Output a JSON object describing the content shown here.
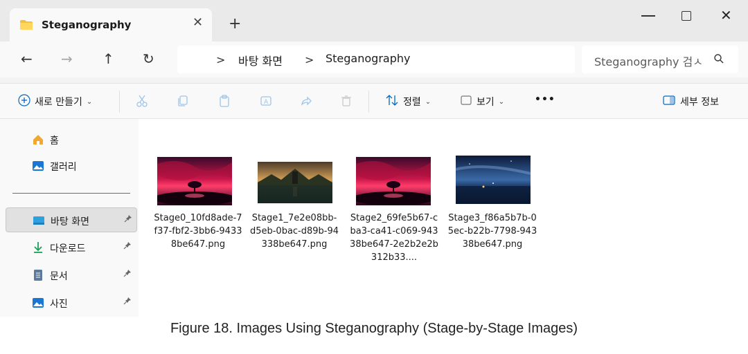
{
  "tab": {
    "title": "Steganography",
    "close_glyph": "✕",
    "new_tab_glyph": "+"
  },
  "window_controls": {
    "close_glyph": "✕"
  },
  "nav": {
    "back_glyph": "←",
    "forward_glyph": "→",
    "up_glyph": "↑",
    "refresh_glyph": "↻"
  },
  "address": {
    "sep1": ">",
    "crumb1": "바탕 화면",
    "sep2": ">",
    "crumb2": "Steganography"
  },
  "search": {
    "placeholder": "Steganography 검ㅅ"
  },
  "commands": {
    "new_label": "새로 만들기",
    "sort_label": "정렬",
    "view_label": "보기",
    "more_label": "•••",
    "details_label": "세부 정보",
    "chevron": "⌄"
  },
  "sidebar": {
    "items": [
      {
        "label": "홈"
      },
      {
        "label": "갤러리"
      },
      {
        "label": "바탕 화면"
      },
      {
        "label": "다운로드"
      },
      {
        "label": "문서"
      },
      {
        "label": "사진"
      }
    ]
  },
  "files": [
    {
      "name": "Stage0_10fd8ade-7f37-fbf2-3bb6-94338be647.png"
    },
    {
      "name": "Stage1_7e2e08bb-d5eb-0bac-d89b-94338be647.png"
    },
    {
      "name": "Stage2_69fe5b67-cba3-ca41-c069-94338be647-2e2b2e2b312b33...."
    },
    {
      "name": "Stage3_f86a5b7b-05ec-b22b-7798-94338be647.png"
    }
  ],
  "caption": "Figure 18. Images Using Steganography (Stage-by-Stage Images)",
  "colors": {
    "accent": "#0067c0",
    "folder": "#f3c13a"
  }
}
